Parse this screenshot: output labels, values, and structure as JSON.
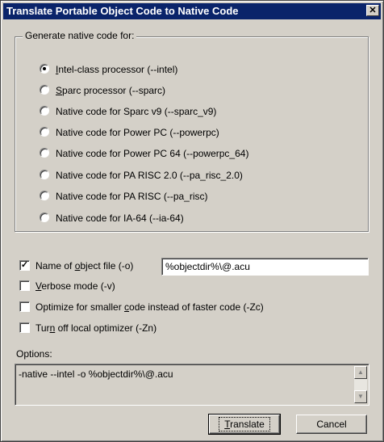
{
  "title": "Translate Portable Object Code to Native Code",
  "close_glyph": "✕",
  "group_label": "Generate native code for:",
  "radios": [
    {
      "pre": "",
      "u": "I",
      "post": "ntel-class processor (--intel)",
      "checked": true
    },
    {
      "pre": "",
      "u": "S",
      "post": "parc processor (--sparc)",
      "checked": false
    },
    {
      "pre": "",
      "u": "",
      "post": "Native code for Sparc v9 (--sparc_v9)",
      "checked": false
    },
    {
      "pre": "",
      "u": "",
      "post": "Native code for Power PC (--powerpc)",
      "checked": false
    },
    {
      "pre": "",
      "u": "",
      "post": "Native code for Power PC 64 (--powerpc_64)",
      "checked": false
    },
    {
      "pre": "",
      "u": "",
      "post": "Native code for PA RISC 2.0 (--pa_risc_2.0)",
      "checked": false
    },
    {
      "pre": "",
      "u": "",
      "post": "Native code for PA RISC (--pa_risc)",
      "checked": false
    },
    {
      "pre": "",
      "u": "",
      "post": "Native code for IA-64 (--ia-64)",
      "checked": false
    }
  ],
  "checks": [
    {
      "pre": "Name of ",
      "u": "o",
      "post": "bject file (-o)",
      "checked": true
    },
    {
      "pre": "",
      "u": "V",
      "post": "erbose mode (-v)",
      "checked": false
    },
    {
      "pre": "Optimize for smaller ",
      "u": "c",
      "post": "ode instead of faster code (-Zc)",
      "checked": false
    },
    {
      "pre": "Tur",
      "u": "n",
      "post": " off local optimizer (-Zn)",
      "checked": false
    }
  ],
  "object_file_value": "%objectdir%\\@.acu",
  "options_label": "Options:",
  "options_text": "-native --intel -o %objectdir%\\@.acu",
  "scroll_up": "▲",
  "scroll_down": "▼",
  "translate_button": {
    "u": "T",
    "post": "ranslate"
  },
  "cancel_button": "Cancel"
}
